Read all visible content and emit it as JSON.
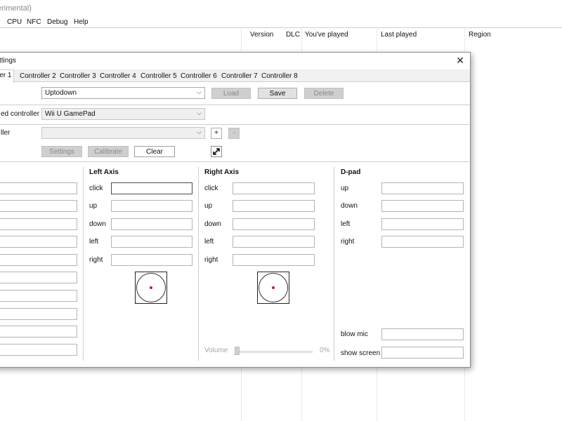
{
  "window": {
    "title_fragment": "erimental)"
  },
  "menu": [
    "CPU",
    "NFC",
    "Debug",
    "Help"
  ],
  "columns": [
    "Version",
    "DLC",
    "You've played",
    "Last played",
    "Region"
  ],
  "dialog": {
    "title": "ttings",
    "close": "✕",
    "tabs": [
      "ler 1",
      "Controller 2",
      "Controller 3",
      "Controller 4",
      "Controller 5",
      "Controller 6",
      "Controller 7",
      "Controller 8"
    ],
    "profile": {
      "value": "Uptodown",
      "load": "Load",
      "save": "Save",
      "delete": "Delete"
    },
    "emulated": {
      "label": "ed controller",
      "value": "Wii U GamePad"
    },
    "controller": {
      "label": "ller",
      "value": "",
      "add": "+",
      "remove": "-",
      "settings": "Settings",
      "calibrate": "Calibrate",
      "clear": "Clear"
    },
    "left_axis": {
      "title": "Left Axis",
      "labels": [
        "click",
        "up",
        "down",
        "left",
        "right"
      ]
    },
    "right_axis": {
      "title": "Right Axis",
      "labels": [
        "click",
        "up",
        "down",
        "left",
        "right"
      ]
    },
    "dpad": {
      "title": "D-pad",
      "labels": [
        "up",
        "down",
        "left",
        "right"
      ]
    },
    "extra": {
      "blow_mic": "blow mic",
      "show_screen": "show screen"
    },
    "volume": {
      "label": "Volume",
      "value": "0%"
    }
  }
}
